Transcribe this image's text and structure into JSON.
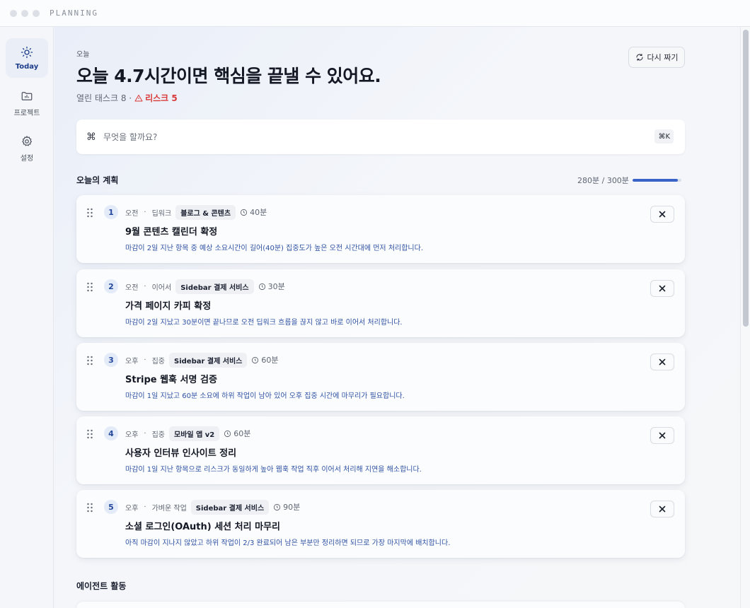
{
  "window": {
    "title": "PLANNING"
  },
  "sidebar": {
    "items": [
      {
        "label": "Today",
        "icon": "sun-icon",
        "active": true
      },
      {
        "label": "프로젝트",
        "icon": "folder-icon",
        "active": false
      },
      {
        "label": "설정",
        "icon": "gear-icon",
        "active": false
      }
    ]
  },
  "header": {
    "eyebrow": "오늘",
    "headline": "오늘 4.7시간이면 핵심을 끝낼 수 있어요.",
    "open_tasks": "열린 태스크 8 ·",
    "risk": "리스크 5",
    "regenerate_label": "다시 짜기"
  },
  "search": {
    "placeholder": "무엇을 할까요?",
    "shortcut": "⌘K"
  },
  "plan": {
    "title": "오늘의 계획",
    "progress_text": "280분 / 300분",
    "progress_fraction": 0.93,
    "items": [
      {
        "num": "1",
        "period": "오전",
        "kind": "딥워크",
        "project": "블로그 & 콘텐츠",
        "duration": "40분",
        "title": "9월 콘텐츠 캘린더 확정",
        "reason": "마감이 2일 지난 항목 중 예상 소요시간이 길어(40분) 집중도가 높은 오전 시간대에 먼저 처리합니다."
      },
      {
        "num": "2",
        "period": "오전",
        "kind": "이어서",
        "project": "Sidebar 결제 서비스",
        "duration": "30분",
        "title": "가격 페이지 카피 확정",
        "reason": "마감이 2일 지났고 30분이면 끝나므로 오전 딥워크 흐름을 끊지 않고 바로 이어서 처리합니다."
      },
      {
        "num": "3",
        "period": "오후",
        "kind": "집중",
        "project": "Sidebar 결제 서비스",
        "duration": "60분",
        "title": "Stripe 웹훅 서명 검증",
        "reason": "마감이 1일 지났고 60분 소요에 하위 작업이 남아 있어 오후 집중 시간에 마무리가 필요합니다."
      },
      {
        "num": "4",
        "period": "오후",
        "kind": "집중",
        "project": "모바일 앱 v2",
        "duration": "60분",
        "title": "사용자 인터뷰 인사이트 정리",
        "reason": "마감이 1일 지난 항목으로 리스크가 동일하게 높아 웹훅 작업 직후 이어서 처리해 지연을 해소합니다."
      },
      {
        "num": "5",
        "period": "오후",
        "kind": "가벼운 작업",
        "project": "Sidebar 결제 서비스",
        "duration": "90분",
        "title": "소셜 로그인(OAuth) 세션 처리 마무리",
        "reason": "아직 마감이 지나지 않았고 하위 작업이 2/3 완료되어 남은 부분만 정리하면 되므로 가장 마지막에 배치합니다."
      }
    ]
  },
  "agent": {
    "title": "에이전트 활동"
  },
  "colors": {
    "accent": "#3a63c8",
    "risk": "#d83a3a",
    "reason": "#2f52a3"
  }
}
